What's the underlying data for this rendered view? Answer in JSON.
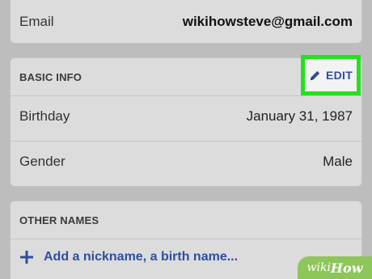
{
  "email_section": {
    "label": "Email",
    "value": "wikihowsteve@gmail.com"
  },
  "basic_info": {
    "title": "BASIC INFO",
    "edit_label": "EDIT",
    "edit_icon": "pencil-icon",
    "birthday": {
      "label": "Birthday",
      "value": "January 31, 1987"
    },
    "gender": {
      "label": "Gender",
      "value": "Male"
    }
  },
  "other_names": {
    "title": "OTHER NAMES",
    "add_icon": "plus-icon",
    "add_label": "Add a nickname, a birth name..."
  },
  "watermark": {
    "part1": "wiki",
    "part2": "How"
  },
  "colors": {
    "highlight": "#25e01f",
    "link_blue": "#2d4e9a",
    "watermark_green": "#8ec65a"
  }
}
